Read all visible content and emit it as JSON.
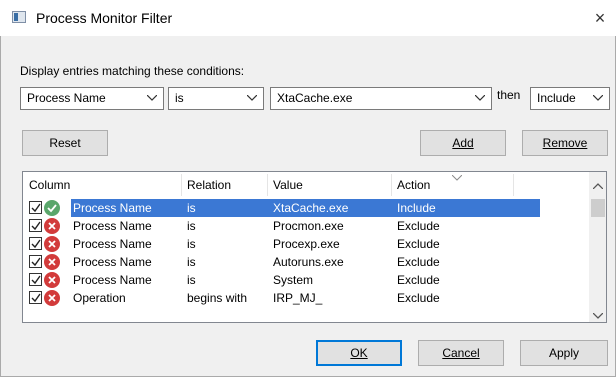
{
  "window": {
    "title": "Process Monitor Filter",
    "close_glyph": "×"
  },
  "condition": {
    "label": "Display entries matching these conditions:",
    "column": "Process Name",
    "relation": "is",
    "value": "XtaCache.exe",
    "then_label": "then",
    "action": "Include"
  },
  "buttons": {
    "reset": "Reset",
    "add": "Add",
    "remove": "Remove",
    "ok": "OK",
    "cancel": "Cancel",
    "apply": "Apply"
  },
  "table": {
    "headers": [
      "Column",
      "Relation",
      "Value",
      "Action"
    ],
    "rows": [
      {
        "checked": true,
        "status": "include",
        "column": "Process Name",
        "relation": "is",
        "value": "XtaCache.exe",
        "action": "Include",
        "selected": true
      },
      {
        "checked": true,
        "status": "exclude",
        "column": "Process Name",
        "relation": "is",
        "value": "Procmon.exe",
        "action": "Exclude"
      },
      {
        "checked": true,
        "status": "exclude",
        "column": "Process Name",
        "relation": "is",
        "value": "Procexp.exe",
        "action": "Exclude"
      },
      {
        "checked": true,
        "status": "exclude",
        "column": "Process Name",
        "relation": "is",
        "value": "Autoruns.exe",
        "action": "Exclude"
      },
      {
        "checked": true,
        "status": "exclude",
        "column": "Process Name",
        "relation": "is",
        "value": "System",
        "action": "Exclude"
      },
      {
        "checked": true,
        "status": "exclude",
        "column": "Operation",
        "relation": "begins with",
        "value": "IRP_MJ_",
        "action": "Exclude"
      }
    ]
  },
  "icons": {
    "include": "green-check-icon",
    "exclude": "red-x-icon",
    "chevron": "chevron-down-icon"
  },
  "colors": {
    "selection": "#3b78d4",
    "include": "#5aa66b",
    "exclude": "#d23b3b",
    "default_button_border": "#0078d7"
  }
}
